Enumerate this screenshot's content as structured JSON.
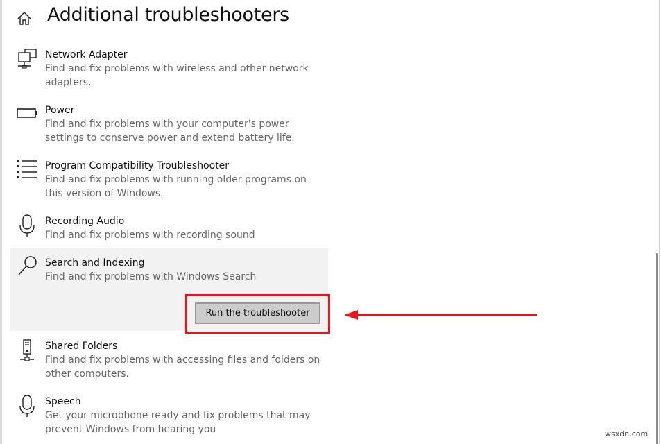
{
  "page_title": "Additional troubleshooters",
  "items": [
    {
      "title": "Network Adapter",
      "description": "Find and fix problems with wireless and other network adapters.",
      "icon": "network-adapter-icon"
    },
    {
      "title": "Power",
      "description": "Find and fix problems with your computer's power settings to conserve power and extend battery life.",
      "icon": "battery-icon"
    },
    {
      "title": "Program Compatibility Troubleshooter",
      "description": "Find and fix problems with running older programs on this version of Windows.",
      "icon": "list-icon"
    },
    {
      "title": "Recording Audio",
      "description": "Find and fix problems with recording sound",
      "icon": "microphone-icon"
    },
    {
      "title": "Search and Indexing",
      "description": "Find and fix problems with Windows Search",
      "icon": "search-icon"
    },
    {
      "title": "Shared Folders",
      "description": "Find and fix problems with accessing files and folders on other computers.",
      "icon": "shared-folders-icon"
    },
    {
      "title": "Speech",
      "description": "Get your microphone ready and fix problems that may prevent Windows from hearing you",
      "icon": "microphone-icon"
    }
  ],
  "run_button_label": "Run the troubleshooter",
  "annotation": {
    "highlight_color": "#e8141b"
  },
  "watermark": "wsxdn.com"
}
